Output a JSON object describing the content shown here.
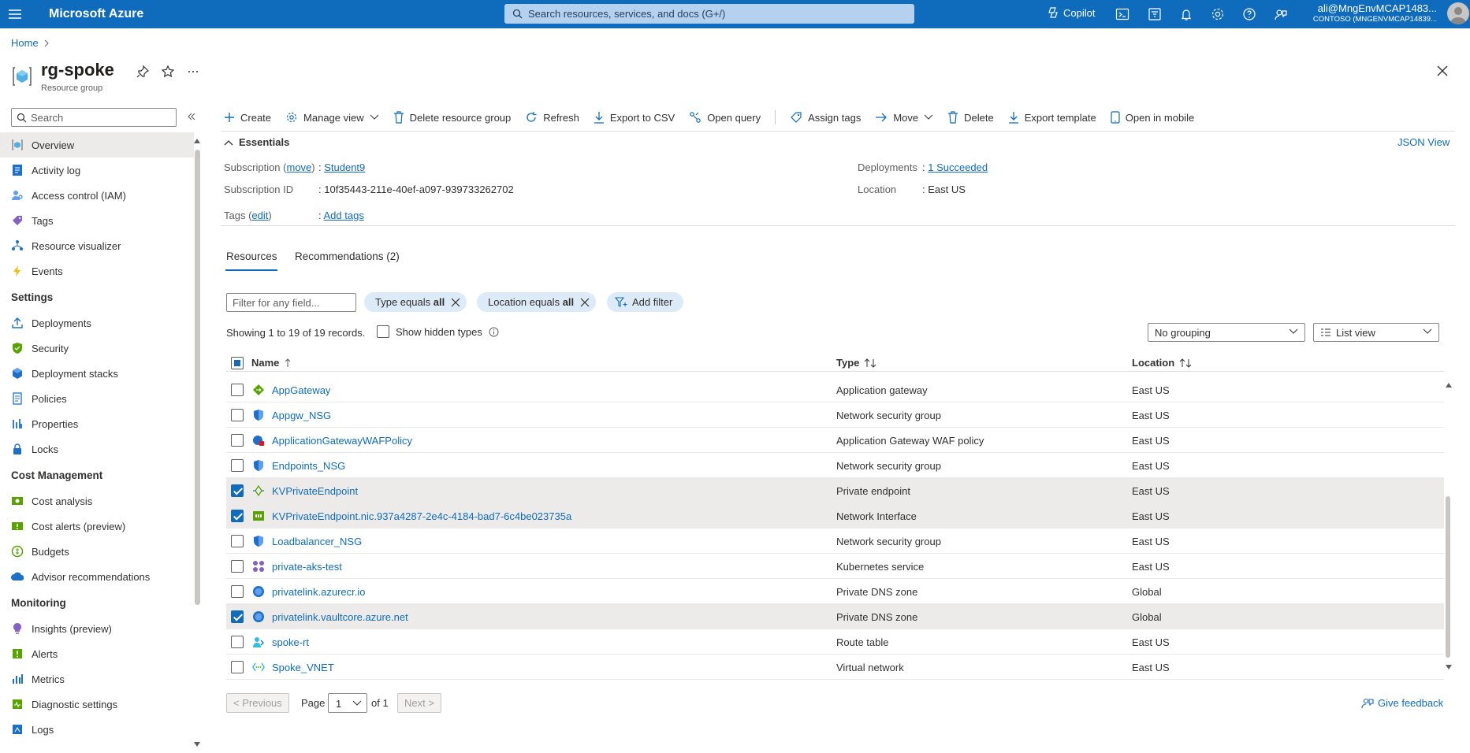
{
  "topbar": {
    "brand": "Microsoft Azure",
    "search_placeholder": "Search resources, services, and docs (G+/)",
    "copilot": "Copilot",
    "user_name": "ali@MngEnvMCAP1483...",
    "user_tenant": "CONTOSO (MNGENVMCAP14839..."
  },
  "breadcrumb": {
    "home": "Home"
  },
  "header": {
    "title": "rg-spoke",
    "subtitle": "Resource group"
  },
  "sidebar": {
    "search_placeholder": "Search",
    "top_items": [
      {
        "label": "Overview",
        "icon": "overview-icon"
      },
      {
        "label": "Activity log",
        "icon": "activity-log-icon"
      },
      {
        "label": "Access control (IAM)",
        "icon": "iam-icon"
      },
      {
        "label": "Tags",
        "icon": "tag-icon"
      },
      {
        "label": "Resource visualizer",
        "icon": "visualizer-icon"
      },
      {
        "label": "Events",
        "icon": "lightning-icon"
      }
    ],
    "settings_heading": "Settings",
    "settings_items": [
      {
        "label": "Deployments",
        "icon": "deploy-icon"
      },
      {
        "label": "Security",
        "icon": "shield-icon"
      },
      {
        "label": "Deployment stacks",
        "icon": "cube-icon"
      },
      {
        "label": "Policies",
        "icon": "policy-icon"
      },
      {
        "label": "Properties",
        "icon": "properties-icon"
      },
      {
        "label": "Locks",
        "icon": "lock-icon"
      }
    ],
    "cost_heading": "Cost Management",
    "cost_items": [
      {
        "label": "Cost analysis",
        "icon": "cost-analysis-icon"
      },
      {
        "label": "Cost alerts (preview)",
        "icon": "cost-alert-icon"
      },
      {
        "label": "Budgets",
        "icon": "budget-icon"
      },
      {
        "label": "Advisor recommendations",
        "icon": "advisor-icon"
      }
    ],
    "monitoring_heading": "Monitoring",
    "monitoring_items": [
      {
        "label": "Insights (preview)",
        "icon": "insights-icon"
      },
      {
        "label": "Alerts",
        "icon": "alert-icon"
      },
      {
        "label": "Metrics",
        "icon": "metrics-icon"
      },
      {
        "label": "Diagnostic settings",
        "icon": "diagnostic-icon"
      },
      {
        "label": "Logs",
        "icon": "logs-icon"
      }
    ]
  },
  "toolbar": {
    "create": "Create",
    "manage_view": "Manage view",
    "delete_rg": "Delete resource group",
    "refresh": "Refresh",
    "export_csv": "Export to CSV",
    "open_query": "Open query",
    "assign_tags": "Assign tags",
    "move": "Move",
    "delete": "Delete",
    "export_template": "Export template",
    "open_mobile": "Open in mobile"
  },
  "essentials": {
    "heading": "Essentials",
    "json_view": "JSON View",
    "subscription_label": "Subscription",
    "move_link": "move",
    "subscription_value": "Student9",
    "subscription_id_label": "Subscription ID",
    "subscription_id_value": "10f35443-211e-40ef-a097-939733262702",
    "tags_label": "Tags",
    "edit_link": "edit",
    "tags_value": "Add tags",
    "deployments_label": "Deployments",
    "deployments_value": "1 Succeeded",
    "location_label": "Location",
    "location_value": "East US"
  },
  "tabs": {
    "resources": "Resources",
    "recommendations": "Recommendations (2)"
  },
  "filters": {
    "placeholder": "Filter for any field...",
    "type_prefix": "Type equals",
    "type_value": "all",
    "location_prefix": "Location equals",
    "location_value": "all",
    "add_filter": "Add filter"
  },
  "records": {
    "showing": "Showing 1 to 19 of 19 records.",
    "show_hidden": "Show hidden types",
    "grouping": "No grouping",
    "view": "List view"
  },
  "table": {
    "columns": {
      "name": "Name",
      "type": "Type",
      "location": "Location"
    },
    "rows": [
      {
        "name": "AppGateway",
        "type": "Application gateway",
        "location": "East US",
        "checked": false,
        "icon": "app-gateway-icon"
      },
      {
        "name": "Appgw_NSG",
        "type": "Network security group",
        "location": "East US",
        "checked": false,
        "icon": "nsg-icon"
      },
      {
        "name": "ApplicationGatewayWAFPolicy",
        "type": "Application Gateway WAF policy",
        "location": "East US",
        "checked": false,
        "icon": "waf-policy-icon"
      },
      {
        "name": "Endpoints_NSG",
        "type": "Network security group",
        "location": "East US",
        "checked": false,
        "icon": "nsg-icon"
      },
      {
        "name": "KVPrivateEndpoint",
        "type": "Private endpoint",
        "location": "East US",
        "checked": true,
        "icon": "private-endpoint-icon"
      },
      {
        "name": "KVPrivateEndpoint.nic.937a4287-2e4c-4184-bad7-6c4be023735a",
        "type": "Network Interface",
        "location": "East US",
        "checked": true,
        "icon": "nic-icon"
      },
      {
        "name": "Loadbalancer_NSG",
        "type": "Network security group",
        "location": "East US",
        "checked": false,
        "icon": "nsg-icon"
      },
      {
        "name": "private-aks-test",
        "type": "Kubernetes service",
        "location": "East US",
        "checked": false,
        "icon": "aks-icon"
      },
      {
        "name": "privatelink.azurecr.io",
        "type": "Private DNS zone",
        "location": "Global",
        "checked": false,
        "icon": "dns-icon"
      },
      {
        "name": "privatelink.vaultcore.azure.net",
        "type": "Private DNS zone",
        "location": "Global",
        "checked": true,
        "icon": "dns-icon"
      },
      {
        "name": "spoke-rt",
        "type": "Route table",
        "location": "East US",
        "checked": false,
        "icon": "route-table-icon"
      },
      {
        "name": "Spoke_VNET",
        "type": "Virtual network",
        "location": "East US",
        "checked": false,
        "icon": "vnet-icon"
      }
    ]
  },
  "pagination": {
    "previous": "< Previous",
    "page_label": "Page",
    "page_value": "1",
    "of_label": "of 1",
    "next": "Next >",
    "feedback": "Give feedback"
  }
}
